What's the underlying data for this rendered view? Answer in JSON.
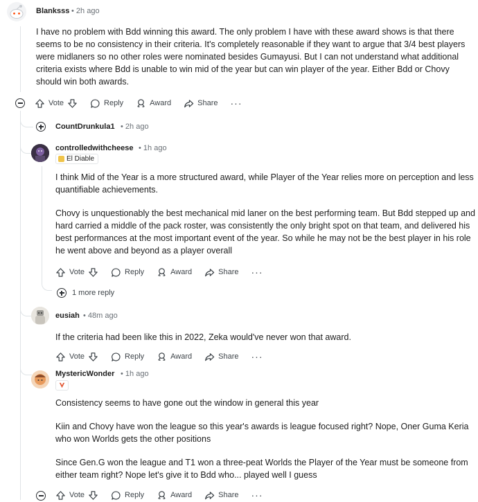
{
  "comments": [
    {
      "username": "Blanksss",
      "time": "2h ago",
      "paragraphs": [
        "I have no problem with Bdd winning this award. The only problem I have with these award shows is that there seems to be no consistency in their criteria. It's completely reasonable if they want to argue that 3/4 best players were midlaners so no other roles were nominated besides Gumayusi. But I can not understand what additional criteria exists where Bdd is unable to win mid of the year but can win player of the year. Either Bdd or Chovy should win both awards."
      ]
    },
    {
      "username": "CountDrunkula1",
      "time": "2h ago"
    },
    {
      "username": "controlledwithcheese",
      "time": "1h ago",
      "flair": "El Diable",
      "paragraphs": [
        "I think Mid of the Year is a more structured award, while Player of the Year relies more on perception and less quantifiable achievements.",
        "Chovy is unquestionably the best mechanical mid laner on the best performing team. But Bdd stepped up and hard carried a middle of the pack roster, was consistently the only bright spot on that team, and delivered his best performances at the most important event of the year. So while he may not be the best player in his role he went above and beyond as a player overall"
      ],
      "more_replies": "1 more reply"
    },
    {
      "username": "eusiah",
      "time": "48m ago",
      "paragraphs": [
        "If the criteria had been like this in 2022, Zeka would've never won that award."
      ]
    },
    {
      "username": "MystericWonder",
      "time": "1h ago",
      "paragraphs": [
        "Consistency seems to have gone out the window in general this year",
        "Kiin and Chovy have won the league so this year's awards is league focused right? Nope, Oner Guma Keria who won Worlds gets the other positions",
        "Since Gen.G won the league and T1 won a three-peat Worlds the Player of the Year must be someone from either team right? Nope let's give it to Bdd who... played well I guess"
      ]
    }
  ],
  "actions": {
    "vote": "Vote",
    "reply": "Reply",
    "award": "Award",
    "share": "Share",
    "more": "···"
  },
  "separator": "•",
  "colors": {
    "thread_line": "#dfe3e6",
    "meta_text": "#6a7076",
    "action_text": "#3e4449"
  }
}
